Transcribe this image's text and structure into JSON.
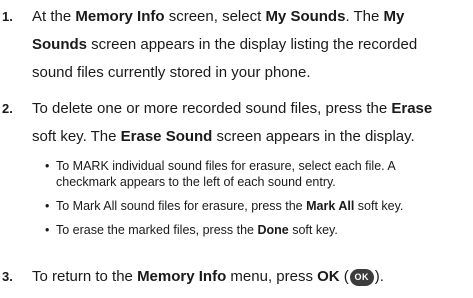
{
  "steps": [
    {
      "number": "1.",
      "lines": [
        [
          {
            "t": "At the ",
            "b": false
          },
          {
            "t": "Memory Info",
            "b": true
          },
          {
            "t": " screen, select ",
            "b": false
          },
          {
            "t": "My Sounds",
            "b": true
          },
          {
            "t": ". The ",
            "b": false
          },
          {
            "t": "My",
            "b": true
          }
        ],
        [
          {
            "t": "Sounds",
            "b": true
          },
          {
            "t": " screen appears in the display listing the recorded",
            "b": false
          }
        ],
        [
          {
            "t": "sound files currently stored in your phone.",
            "b": false
          }
        ]
      ]
    },
    {
      "number": "2.",
      "lines": [
        [
          {
            "t": "To delete one or more recorded sound files, press the ",
            "b": false
          },
          {
            "t": "Erase",
            "b": true
          }
        ],
        [
          {
            "t": "soft key. The ",
            "b": false
          },
          {
            "t": "Erase Sound",
            "b": true
          },
          {
            "t": " screen appears in the display.",
            "b": false
          }
        ]
      ]
    },
    {
      "number": "3.",
      "lines": [
        [
          {
            "t": "To return to the ",
            "b": false
          },
          {
            "t": "Memory Info",
            "b": true
          },
          {
            "t": " menu, press ",
            "b": false
          },
          {
            "t": "OK",
            "b": true
          },
          {
            "t": " (",
            "b": false
          },
          {
            "icon": "ok-key-icon",
            "label": "OK"
          },
          {
            "t": ").",
            "b": false
          }
        ]
      ]
    }
  ],
  "bullets": [
    {
      "lines": [
        [
          {
            "t": "To MARK individual sound files for erasure, select each file. A",
            "b": false
          }
        ],
        [
          {
            "t": "checkmark appears to the left of each sound entry.",
            "b": false
          }
        ]
      ]
    },
    {
      "lines": [
        [
          {
            "t": "To Mark All sound files for erasure, press the ",
            "b": false
          },
          {
            "t": "Mark All",
            "b": true
          },
          {
            "t": " soft key.",
            "b": false
          }
        ]
      ]
    },
    {
      "lines": [
        [
          {
            "t": "To erase the marked files, press the ",
            "b": false
          },
          {
            "t": "Done",
            "b": true
          },
          {
            "t": " soft key.",
            "b": false
          }
        ]
      ]
    }
  ],
  "bullet_char": "•"
}
